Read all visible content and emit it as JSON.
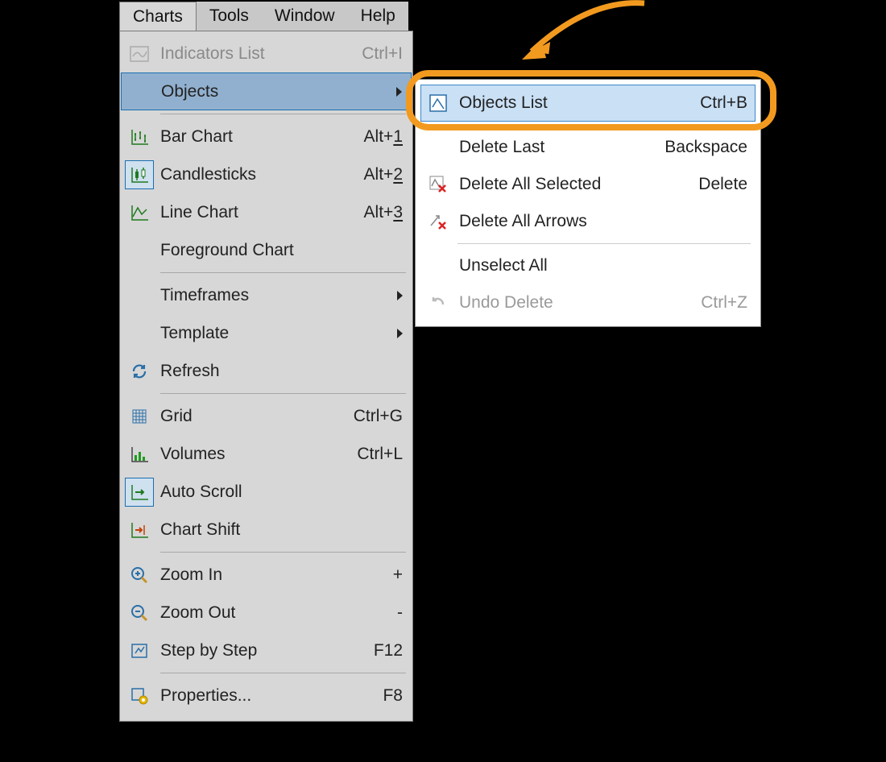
{
  "menubar": {
    "items": [
      {
        "label": "Charts",
        "active": true
      },
      {
        "label": "Tools"
      },
      {
        "label": "Window"
      },
      {
        "label": "Help"
      }
    ]
  },
  "charts_menu": {
    "indicators_list": {
      "label": "Indicators List",
      "shortcut": "Ctrl+I",
      "disabled": true
    },
    "objects": {
      "label": "Objects",
      "highlight": true,
      "has_submenu": true
    },
    "bar_chart": {
      "label": "Bar Chart",
      "shortcut_prefix": "Alt+",
      "shortcut_key": "1"
    },
    "candlesticks": {
      "label": "Candlesticks",
      "shortcut_prefix": "Alt+",
      "shortcut_key": "2",
      "icon_boxed": true
    },
    "line_chart": {
      "label": "Line Chart",
      "shortcut_prefix": "Alt+",
      "shortcut_key": "3"
    },
    "foreground_chart": {
      "label": "Foreground Chart"
    },
    "timeframes": {
      "label": "Timeframes",
      "has_submenu": true
    },
    "template": {
      "label": "Template",
      "has_submenu": true
    },
    "refresh": {
      "label": "Refresh"
    },
    "grid": {
      "label": "Grid",
      "shortcut": "Ctrl+G"
    },
    "volumes": {
      "label": "Volumes",
      "shortcut": "Ctrl+L"
    },
    "auto_scroll": {
      "label": "Auto Scroll",
      "icon_boxed": true
    },
    "chart_shift": {
      "label": "Chart Shift"
    },
    "zoom_in": {
      "label": "Zoom In",
      "shortcut": "+"
    },
    "zoom_out": {
      "label": "Zoom Out",
      "shortcut": "-"
    },
    "step_by_step": {
      "label": "Step by Step",
      "shortcut": "F12"
    },
    "properties": {
      "label": "Properties...",
      "shortcut": "F8"
    }
  },
  "objects_submenu": {
    "objects_list": {
      "label": "Objects List",
      "shortcut": "Ctrl+B",
      "highlight": true
    },
    "delete_last": {
      "label": "Delete Last",
      "shortcut": "Backspace"
    },
    "delete_all_selected": {
      "label": "Delete All Selected",
      "shortcut": "Delete"
    },
    "delete_all_arrows": {
      "label": "Delete All Arrows"
    },
    "unselect_all": {
      "label": "Unselect All"
    },
    "undo_delete": {
      "label": "Undo Delete",
      "shortcut": "Ctrl+Z",
      "disabled": true
    }
  }
}
